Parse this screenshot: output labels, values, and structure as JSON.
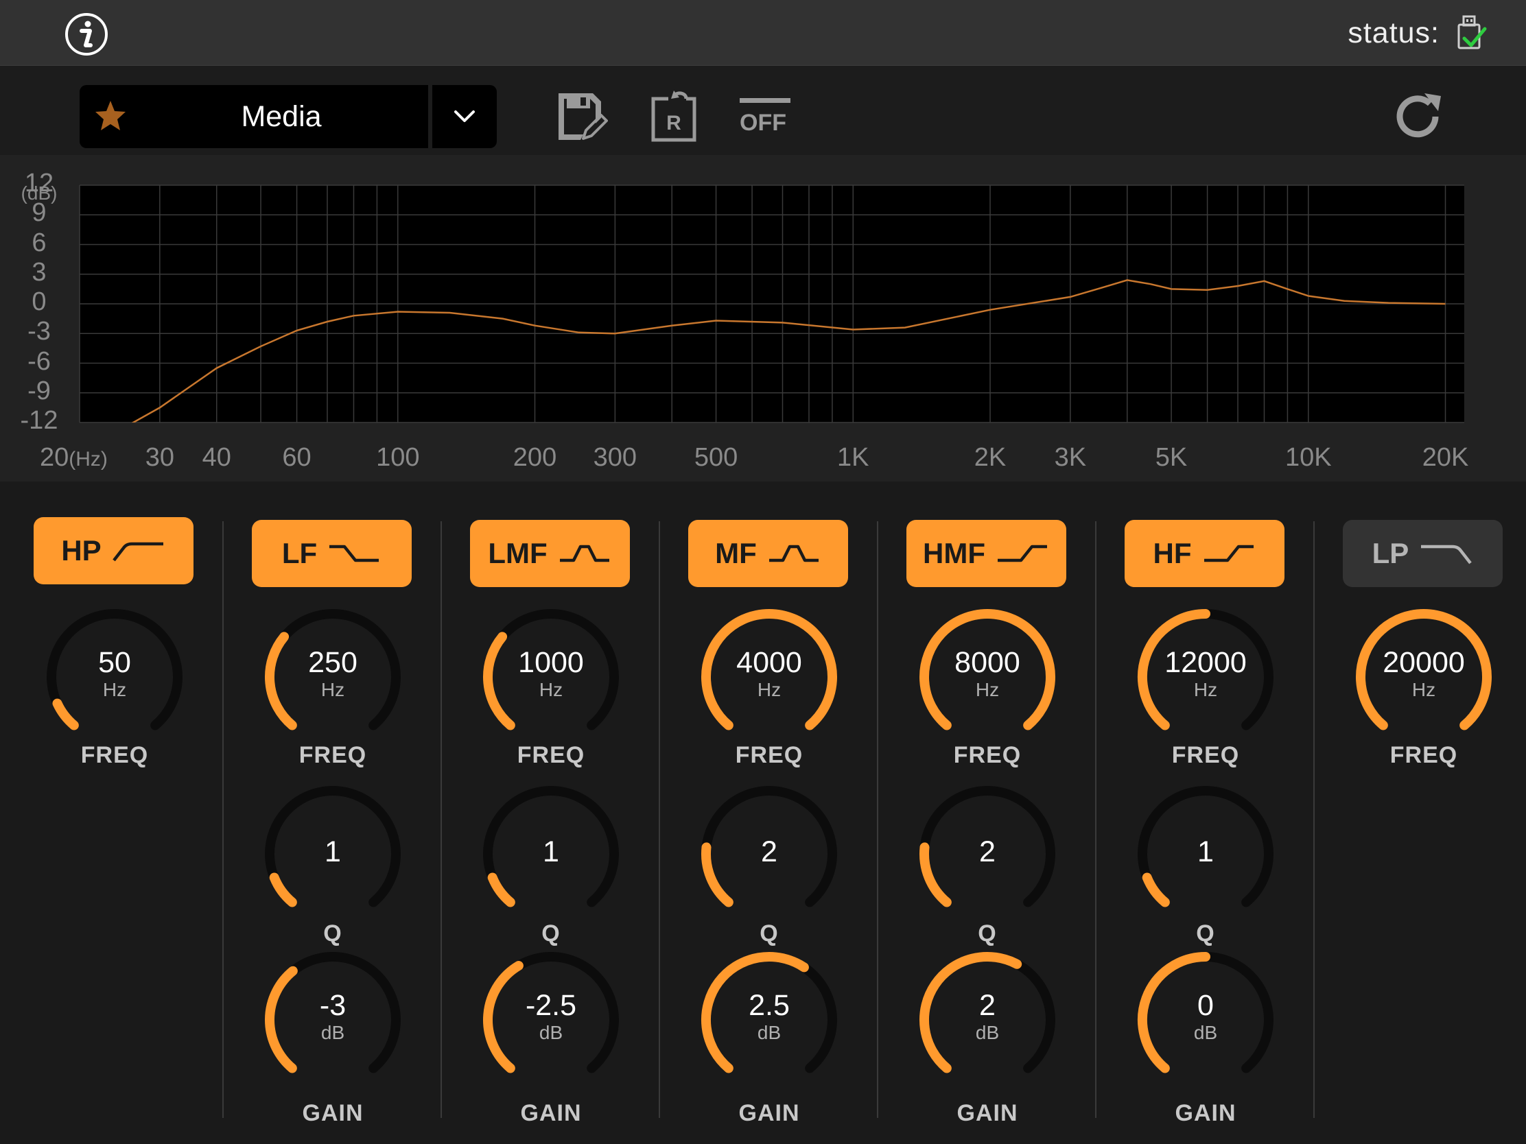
{
  "status": {
    "label": "status:"
  },
  "preset": {
    "name": "Media"
  },
  "toolbar": {
    "off_label": "OFF"
  },
  "graph": {
    "y_ticks": [
      "12",
      "9",
      "6",
      "3",
      "0",
      "-3",
      "-6",
      "-9",
      "-12"
    ],
    "y_unit": "(dB)",
    "x_ticks": [
      "20",
      "30",
      "40",
      "60",
      "100",
      "200",
      "300",
      "500",
      "1K",
      "2K",
      "3K",
      "5K",
      "10K",
      "20K"
    ],
    "x_unit": "(Hz)"
  },
  "chart_data": {
    "type": "line",
    "x_scale": "log",
    "xlim": [
      20,
      22000
    ],
    "ylim": [
      -12,
      12
    ],
    "x": [
      20,
      24,
      30,
      40,
      50,
      60,
      70,
      80,
      100,
      130,
      170,
      200,
      250,
      300,
      400,
      500,
      700,
      1000,
      1300,
      2000,
      3000,
      3500,
      4000,
      4500,
      5000,
      6000,
      7000,
      8000,
      9000,
      10000,
      12000,
      15000,
      20000
    ],
    "y": [
      -15,
      -13,
      -10.5,
      -6.5,
      -4.3,
      -2.7,
      -1.8,
      -1.2,
      -0.8,
      -0.9,
      -1.5,
      -2.2,
      -2.9,
      -3.0,
      -2.2,
      -1.7,
      -1.9,
      -2.6,
      -2.4,
      -0.6,
      0.7,
      1.6,
      2.4,
      2.0,
      1.5,
      1.4,
      1.8,
      2.3,
      1.5,
      0.8,
      0.3,
      0.1,
      0.0
    ]
  },
  "bands": [
    {
      "label": "HP",
      "active": true,
      "shape": "hp",
      "freq": {
        "value": "50",
        "unit": "Hz",
        "label": "FREQ",
        "fraction": 0.09
      }
    },
    {
      "label": "LF",
      "active": true,
      "shape": "lowshelf",
      "freq": {
        "value": "250",
        "unit": "Hz",
        "label": "FREQ",
        "fraction": 0.32
      },
      "q": {
        "value": "1",
        "label": "Q",
        "fraction": 0.1
      },
      "gain": {
        "value": "-3",
        "unit": "dB",
        "label": "GAIN",
        "fraction": 0.36
      }
    },
    {
      "label": "LMF",
      "active": true,
      "shape": "peak",
      "freq": {
        "value": "1000",
        "unit": "Hz",
        "label": "FREQ",
        "fraction": 0.32
      },
      "q": {
        "value": "1",
        "label": "Q",
        "fraction": 0.1
      },
      "gain": {
        "value": "-2.5",
        "unit": "dB",
        "label": "GAIN",
        "fraction": 0.39
      }
    },
    {
      "label": "MF",
      "active": true,
      "shape": "peak",
      "freq": {
        "value": "4000",
        "unit": "Hz",
        "label": "FREQ",
        "fraction": 1.0
      },
      "q": {
        "value": "2",
        "label": "Q",
        "fraction": 0.2
      },
      "gain": {
        "value": "2.5",
        "unit": "dB",
        "label": "GAIN",
        "fraction": 0.62
      }
    },
    {
      "label": "HMF",
      "active": true,
      "shape": "highshelf",
      "freq": {
        "value": "8000",
        "unit": "Hz",
        "label": "FREQ",
        "fraction": 1.0
      },
      "q": {
        "value": "2",
        "label": "Q",
        "fraction": 0.2
      },
      "gain": {
        "value": "2",
        "unit": "dB",
        "label": "GAIN",
        "fraction": 0.6
      }
    },
    {
      "label": "HF",
      "active": true,
      "shape": "highshelf",
      "freq": {
        "value": "12000",
        "unit": "Hz",
        "label": "FREQ",
        "fraction": 0.5
      },
      "q": {
        "value": "1",
        "label": "Q",
        "fraction": 0.1
      },
      "gain": {
        "value": "0",
        "unit": "dB",
        "label": "GAIN",
        "fraction": 0.5
      }
    },
    {
      "label": "LP",
      "active": false,
      "shape": "lp",
      "freq": {
        "value": "20000",
        "unit": "Hz",
        "label": "FREQ",
        "fraction": 1.0
      }
    }
  ],
  "colors": {
    "accent": "#ff9a2e",
    "curve": "#c8772e",
    "check": "#2ecc40"
  }
}
